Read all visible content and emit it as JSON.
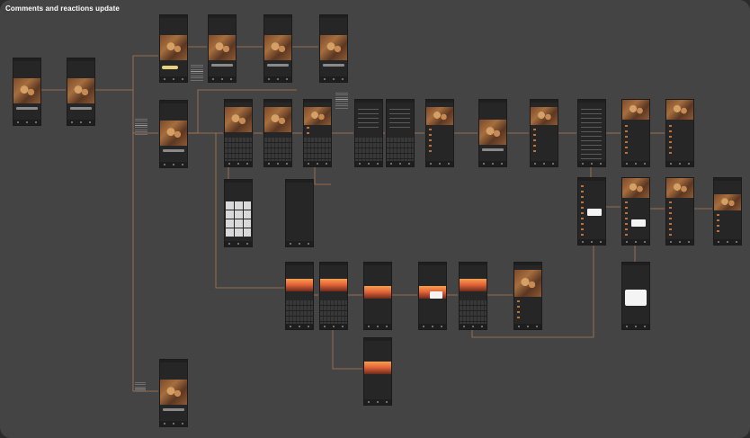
{
  "board": {
    "title": "Comments and reactions update"
  },
  "colors": {
    "canvas": "#444444",
    "frame_border": "#1a1a1a",
    "connector": "#b07a52",
    "screen": "#262626"
  },
  "screens": {
    "photo": [
      {
        "id": "p1"
      },
      {
        "id": "p2"
      },
      {
        "id": "p3"
      },
      {
        "id": "p4"
      },
      {
        "id": "p5"
      },
      {
        "id": "p6"
      },
      {
        "id": "p7"
      },
      {
        "id": "p8"
      },
      {
        "id": "p9"
      },
      {
        "id": "p10"
      },
      {
        "id": "p11"
      },
      {
        "id": "p12"
      },
      {
        "id": "p13"
      },
      {
        "id": "p14"
      },
      {
        "id": "p15"
      },
      {
        "id": "p16"
      },
      {
        "id": "p17"
      }
    ],
    "comments": [
      {
        "id": "c1"
      },
      {
        "id": "c2"
      },
      {
        "id": "c3"
      },
      {
        "id": "c4"
      },
      {
        "id": "c5"
      },
      {
        "id": "c6"
      },
      {
        "id": "c7"
      },
      {
        "id": "c8"
      },
      {
        "id": "c9"
      },
      {
        "id": "c10"
      }
    ],
    "sunset": [
      {
        "id": "s1"
      },
      {
        "id": "s2"
      },
      {
        "id": "s3"
      },
      {
        "id": "s4"
      },
      {
        "id": "s5"
      },
      {
        "id": "s6"
      }
    ],
    "other": [
      {
        "id": "o1"
      },
      {
        "id": "o2"
      },
      {
        "id": "o3"
      }
    ]
  }
}
